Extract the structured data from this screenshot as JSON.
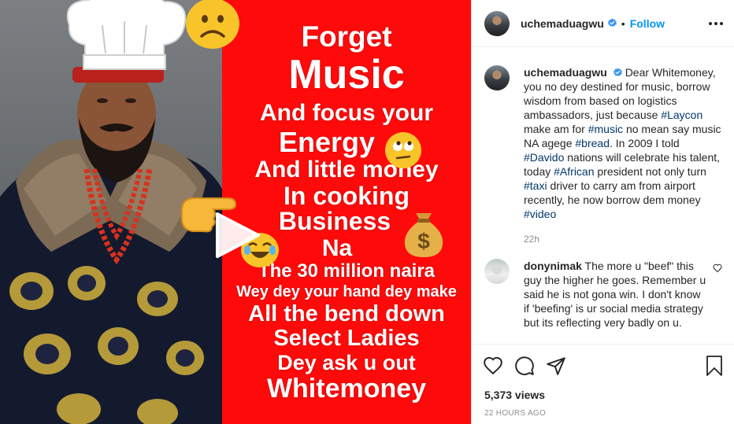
{
  "poster": {
    "lines": [
      "Forget",
      "Music",
      "And focus your",
      "Energy",
      "And little money",
      "In cooking",
      "Business",
      "Na",
      "The 30 million naira",
      "Wey dey your hand dey make",
      "All the bend down",
      "Select Ladies",
      "Dey ask u out",
      "Whitemoney"
    ],
    "money_bag_symbol": "$",
    "colors": {
      "panel": "#ff0a0a",
      "text": "#ffffff",
      "emoji": "#f8c42a"
    }
  },
  "header": {
    "username": "uchemaduagwu",
    "separator": "•",
    "follow_label": "Follow"
  },
  "caption": {
    "username": "uchemaduagwu",
    "t1": "Dear Whitemoney, you no dey destined for music, borrow wisdom from based on logistics ambassadors, just because ",
    "tag1": "#Laycon",
    "t2": " make am for ",
    "tag2": "#music",
    "t3": " no mean say music NA agege ",
    "tag3": "#bread",
    "t4": ". In 2009 I told ",
    "tag4": "#Davido",
    "t5": " nations will celebrate his talent, today ",
    "tag5": "#African",
    "t6": " president not only turn ",
    "tag6": "#taxi",
    "t7": " driver to carry am from airport recently, he now borrow dem money ",
    "tag7": "#video",
    "time": "22h"
  },
  "comments": [
    {
      "username": "donynimak",
      "text": "The more u \"beef\" this guy the higher he goes. Remember u said he is not gona win. I don't know if 'beefing' is ur social media strategy but its reflecting very badly on u."
    }
  ],
  "actions": {
    "views": "5,373 views",
    "posted": "22 HOURS AGO"
  },
  "colors": {
    "accent": "#0095f6",
    "verified": "#3897f0",
    "hashtag": "#00376b",
    "muted": "#8e8e8e"
  }
}
